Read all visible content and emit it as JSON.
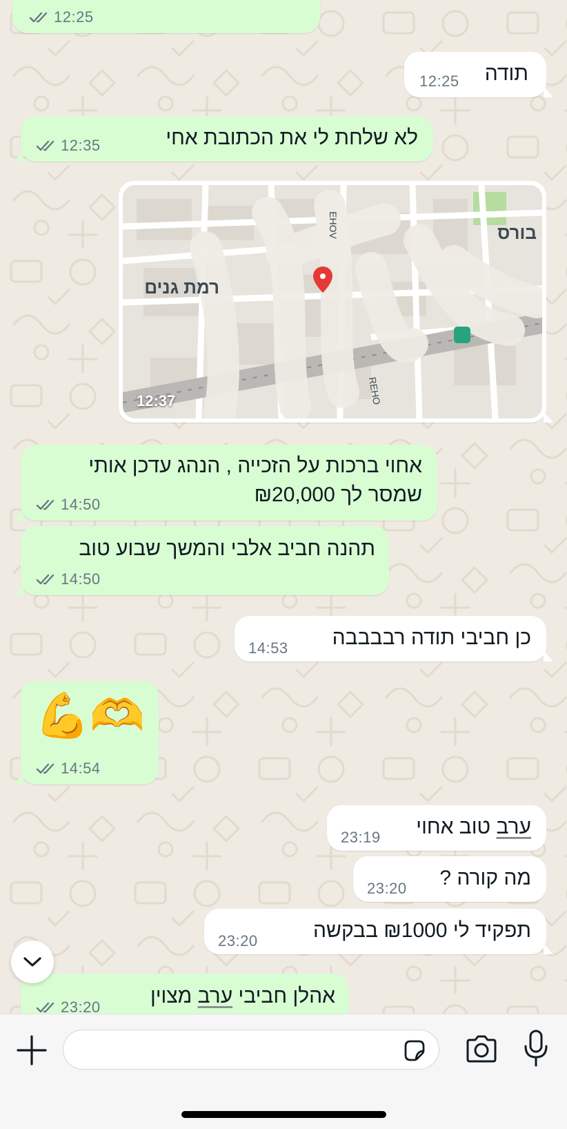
{
  "colors": {
    "outgoing_bubble": "#d9fdd3",
    "incoming_bubble": "#ffffff",
    "background": "#efeae2",
    "timestamp": "#667781",
    "read_ticks": "#667781"
  },
  "messages": [
    {
      "direction": "outgoing",
      "text": "",
      "time": "12:25"
    },
    {
      "direction": "incoming",
      "text": "תודה",
      "time": "12:25"
    },
    {
      "direction": "outgoing",
      "text": "לא שלחת לי את הכתובת אחי",
      "time": "12:35"
    },
    {
      "direction": "incoming",
      "type": "location",
      "time": "12:37",
      "map": {
        "label_gardens": "רמת גנים",
        "label_top": "בורס",
        "street_1": "EHOV",
        "street_2": "REHO"
      }
    },
    {
      "direction": "outgoing",
      "line1": "אחוי ברכות על הזכייה , הנהג עדכן אותי",
      "line2": "שמסר לך ₪20,000",
      "time": "14:50"
    },
    {
      "direction": "outgoing",
      "text": "תהנה חביב אלבי והמשך שבוע טוב",
      "time": "14:50"
    },
    {
      "direction": "incoming",
      "text": "כן חביבי תודה רבבבבה",
      "time": "14:53"
    },
    {
      "direction": "outgoing",
      "type": "emoji",
      "text": "🫶💪",
      "time": "14:54"
    },
    {
      "direction": "incoming",
      "text_word1": "ערב",
      "text_rest": " טוב אחוי",
      "time": "23:19"
    },
    {
      "direction": "incoming",
      "text": "מה קורה ?",
      "time": "23:20"
    },
    {
      "direction": "incoming",
      "text": "תפקיד לי ₪1000 בבקשה",
      "time": "23:20"
    },
    {
      "direction": "outgoing",
      "text_a": "אהלן חביבי ",
      "text_b": "ערב",
      "text_c": " מצוין",
      "time": "23:20"
    }
  ],
  "icons": {
    "scroll_down": "chevron-down-icon",
    "attach": "plus-icon",
    "sticker": "sticker-icon",
    "camera": "camera-icon",
    "mic": "microphone-icon",
    "ticks": "double-check-icon"
  },
  "composer": {
    "value": "",
    "placeholder": ""
  }
}
